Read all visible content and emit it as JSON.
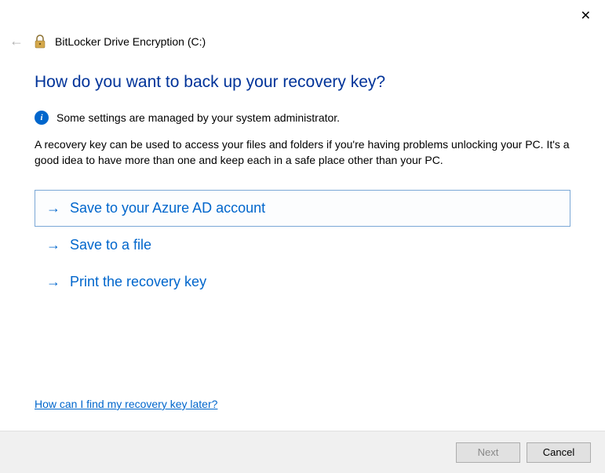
{
  "window": {
    "title": "BitLocker Drive Encryption (C:)"
  },
  "main": {
    "heading": "How do you want to back up your recovery key?",
    "info_text": "Some settings are managed by your system administrator.",
    "description": "A recovery key can be used to access your files and folders if you're having problems unlocking your PC. It's a good idea to have more than one and keep each in a safe place other than your PC."
  },
  "options": [
    {
      "label": "Save to your Azure AD account",
      "selected": true
    },
    {
      "label": "Save to a file",
      "selected": false
    },
    {
      "label": "Print the recovery key",
      "selected": false
    }
  ],
  "help_link": "How can I find my recovery key later?",
  "footer": {
    "next": "Next",
    "cancel": "Cancel"
  }
}
